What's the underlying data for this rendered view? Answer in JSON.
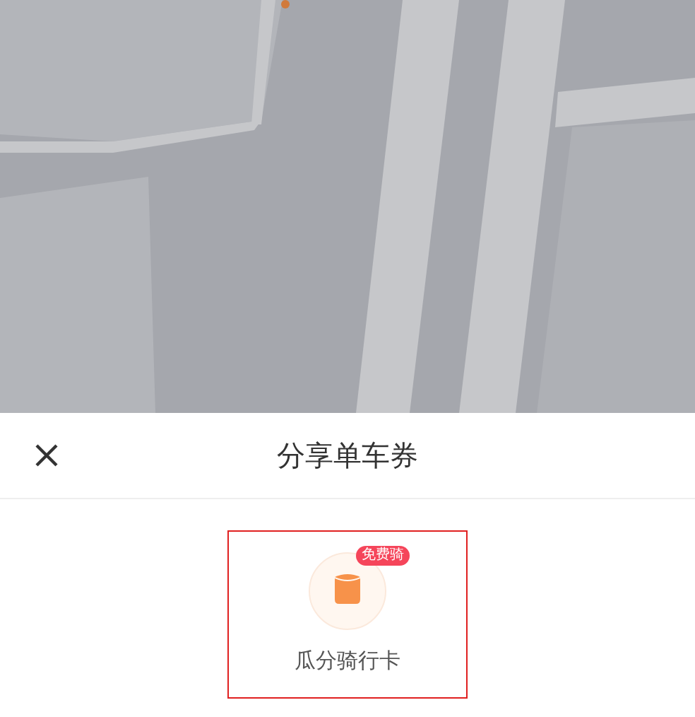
{
  "sheet": {
    "title": "分享单车券",
    "options": [
      {
        "label": "瓜分骑行卡",
        "badge": "免费骑",
        "selected": true
      }
    ]
  }
}
